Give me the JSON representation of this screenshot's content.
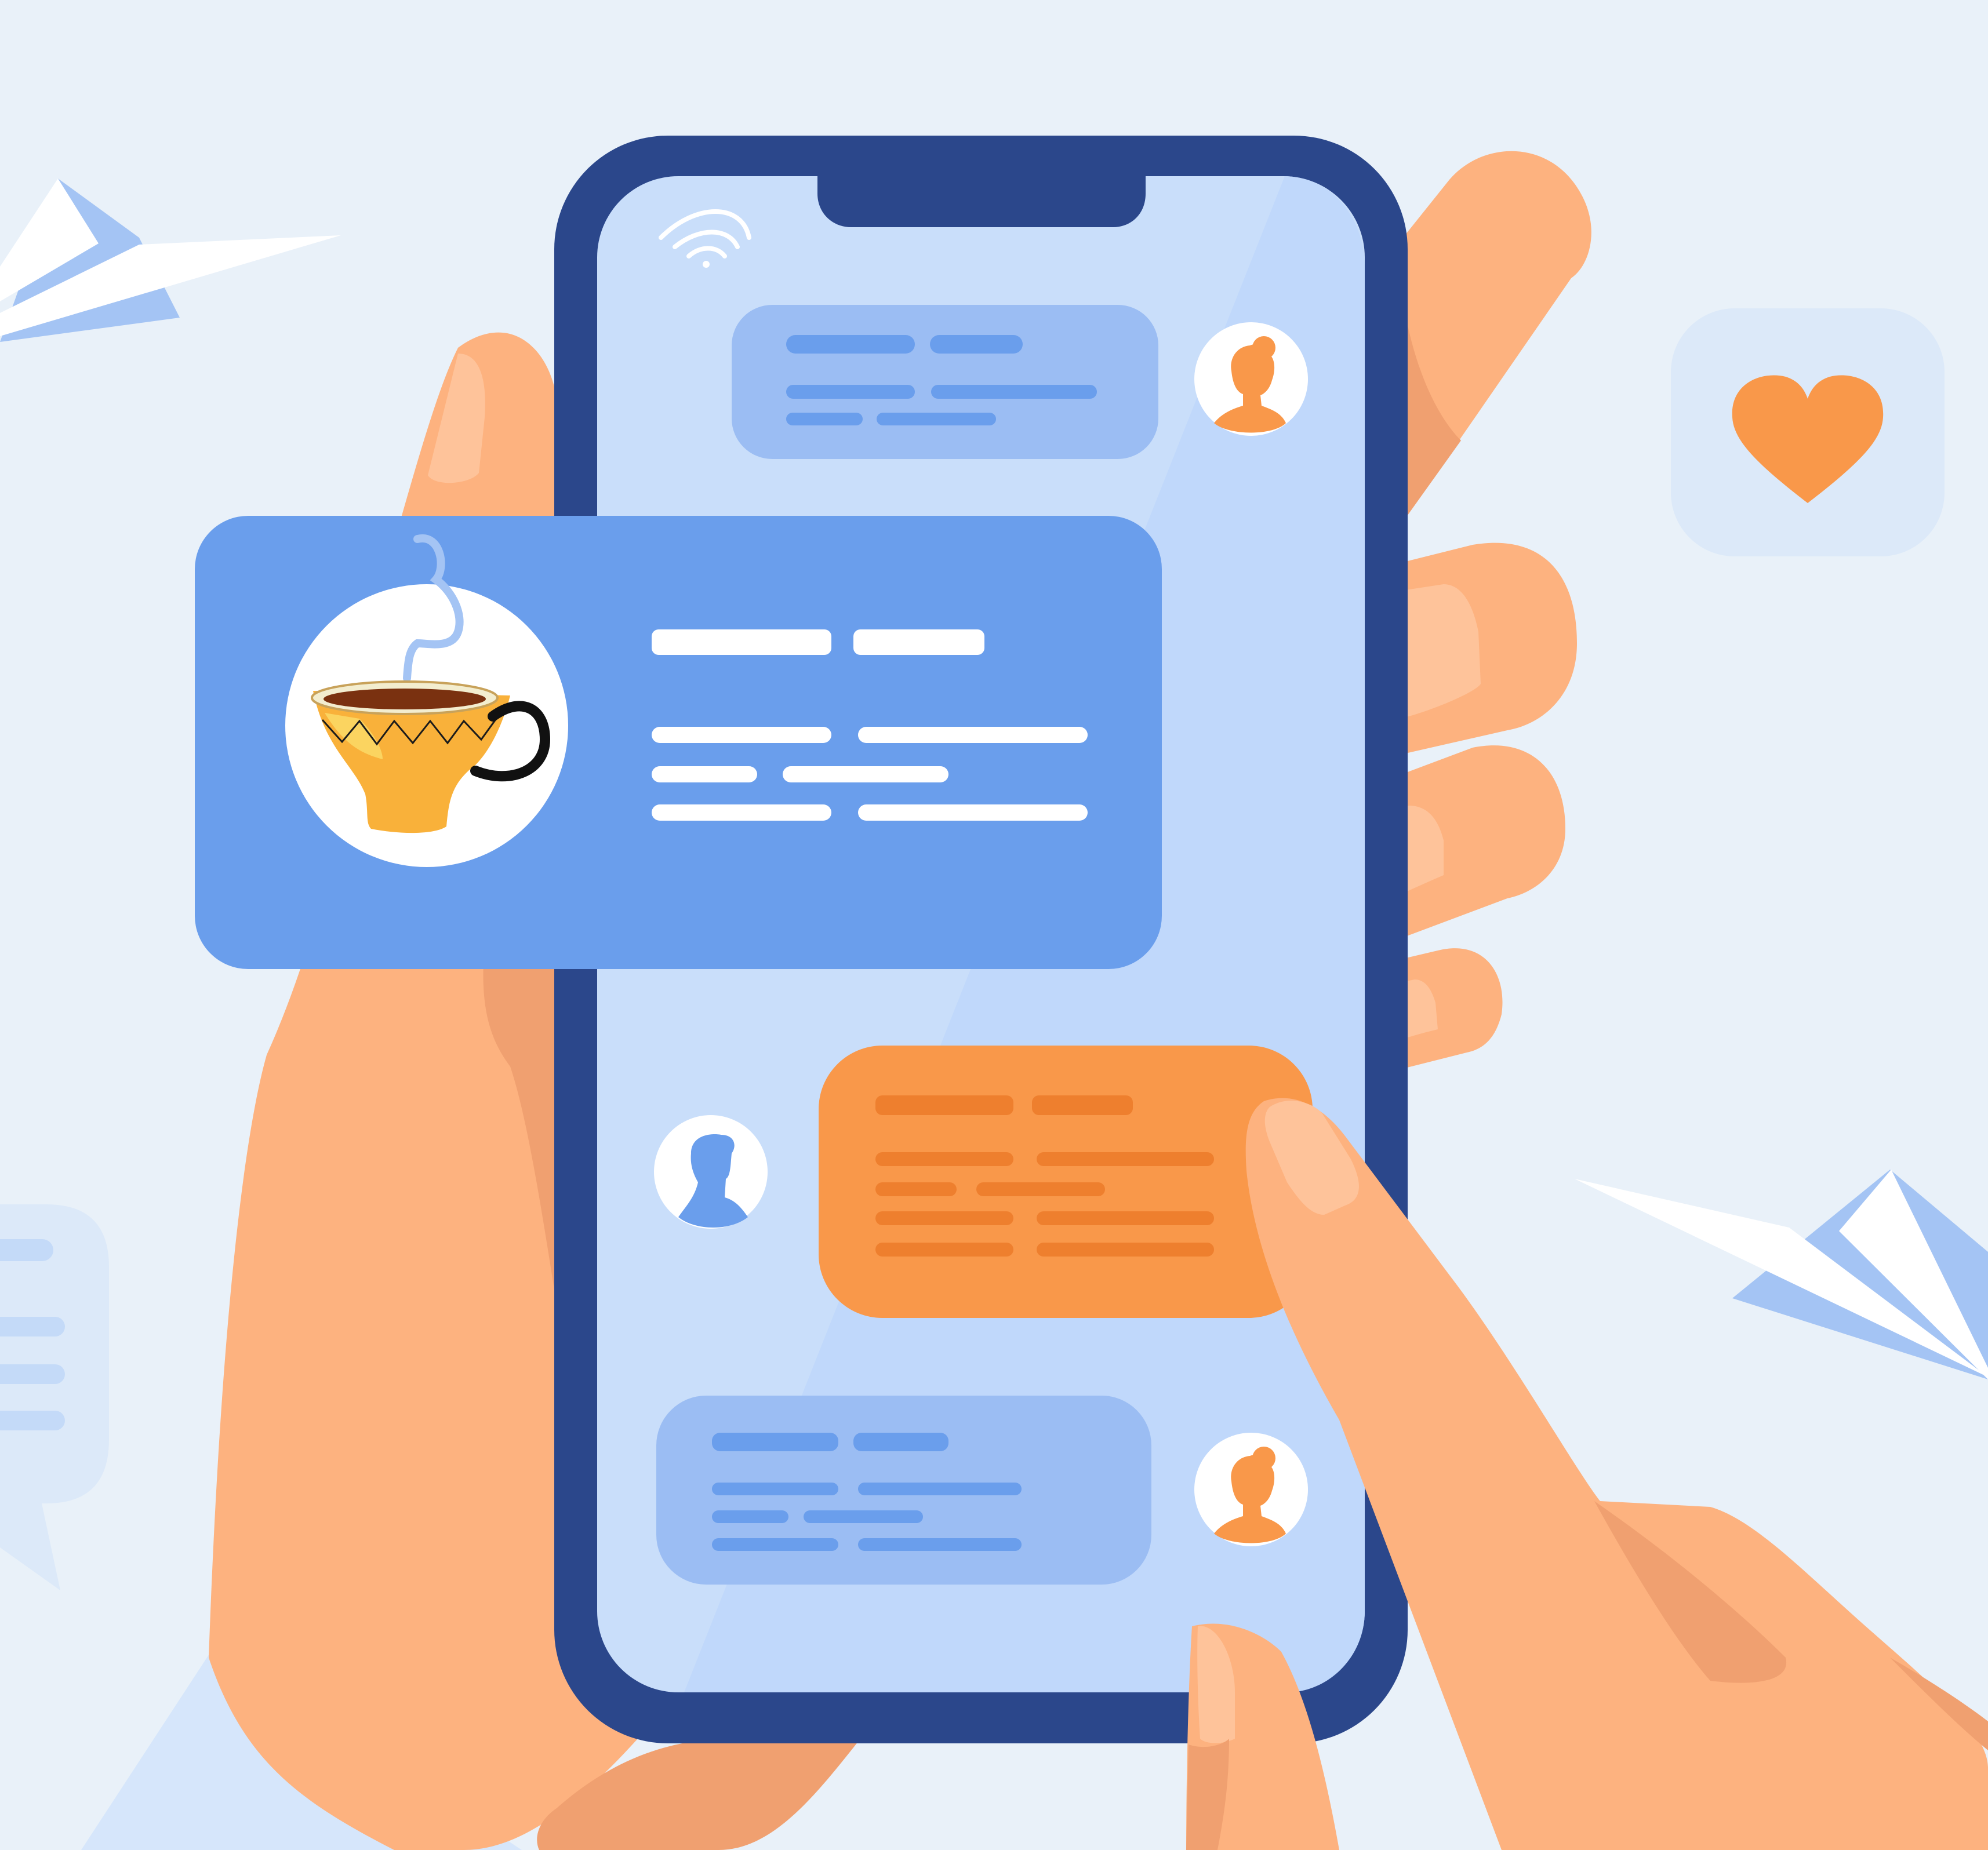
{
  "illustration": {
    "subject": "hands-holding-phone-chat",
    "palette": {
      "background": "#e9f1f9",
      "phone_frame": "#2b478b",
      "phone_screen": "#c9defa",
      "incoming_bubble": "#9bbdf3",
      "outgoing_bubble": "#f9984a",
      "notification_card": "#6a9eec",
      "skin": "#fdb27f",
      "skin_shadow": "#f0a070",
      "nail": "#fec39a",
      "heart": "#f9984a",
      "paper_plane": "#ffffff",
      "paper_plane_fold": "#a4c4f4"
    },
    "icons": [
      "wifi-icon",
      "heart-icon",
      "paper-plane-icon",
      "teacup-icon",
      "avatar-woman-icon",
      "avatar-man-icon",
      "chat-bubble-icon"
    ],
    "chat": {
      "messages": [
        {
          "sender": "contact",
          "avatar": "avatar-woman-icon",
          "bubble_color": "#9bbdf3"
        },
        {
          "sender": "notification",
          "avatar": "teacup-icon",
          "bubble_color": "#6a9eec"
        },
        {
          "sender": "user",
          "avatar": "avatar-man-icon",
          "bubble_color": "#f9984a"
        },
        {
          "sender": "contact",
          "avatar": "avatar-woman-icon",
          "bubble_color": "#9bbdf3"
        }
      ]
    }
  }
}
